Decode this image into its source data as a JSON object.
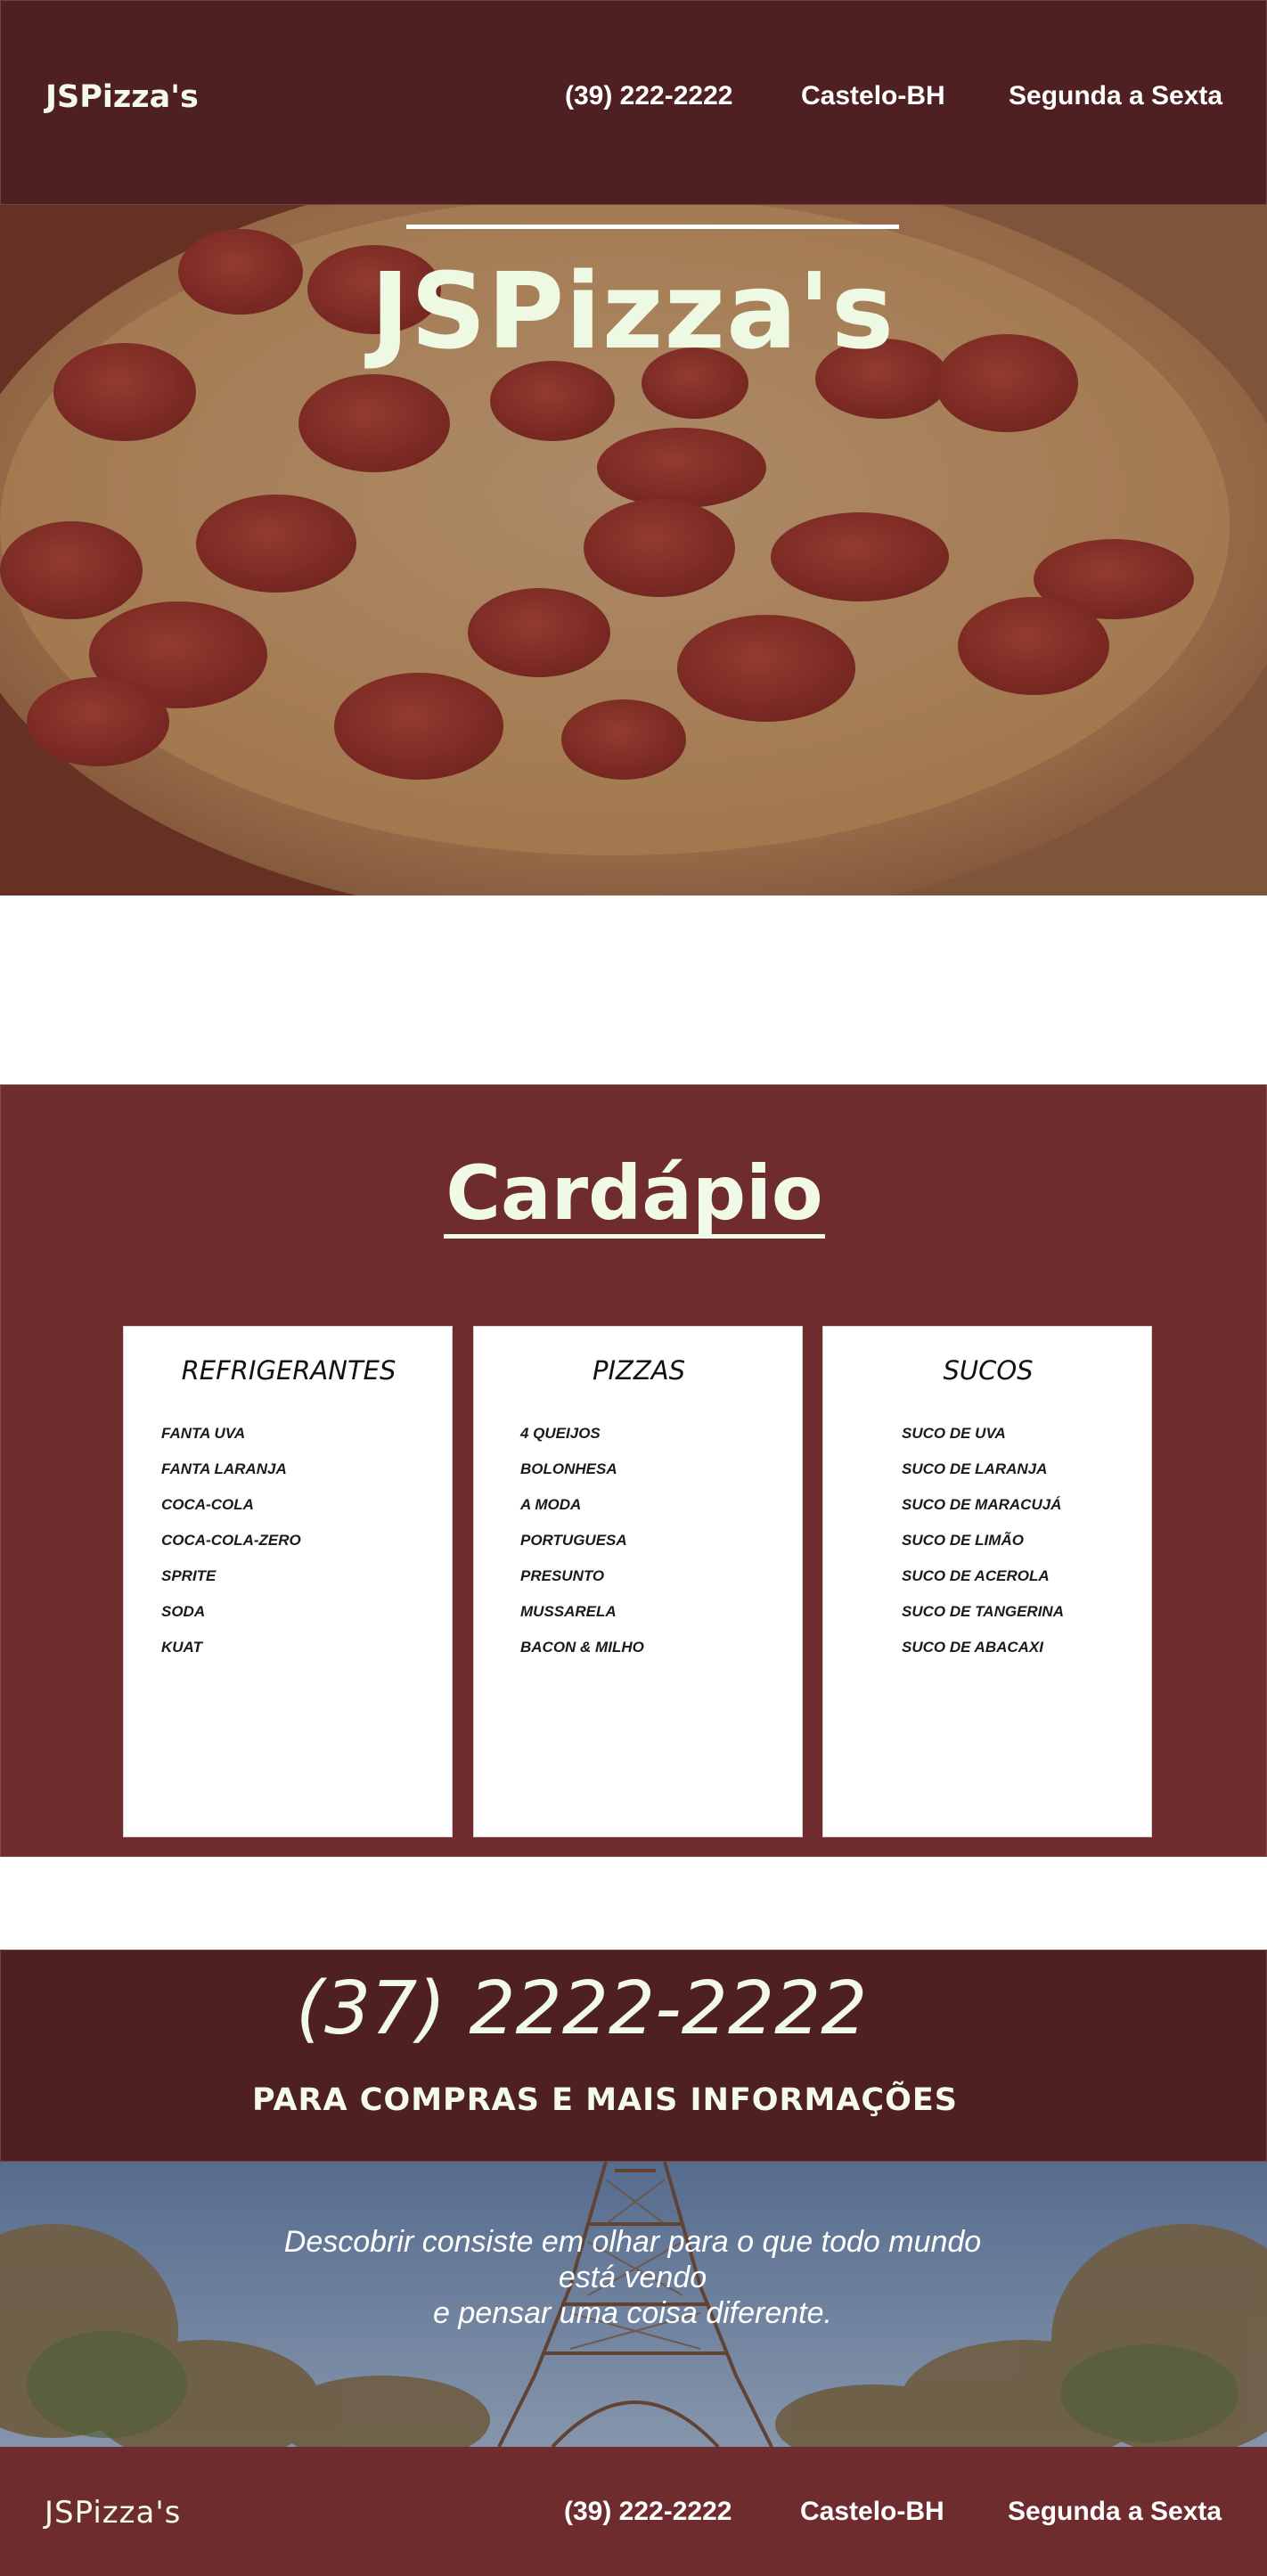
{
  "header": {
    "brand": "JSPizza's",
    "phone": "(39) 222-2222",
    "location": "Castelo-BH",
    "days": "Segunda a Sexta"
  },
  "hero": {
    "title": "JSPizza's",
    "image": "pepperoni-pizza-photo"
  },
  "menu": {
    "title": "Cardápio",
    "cards": [
      {
        "title": "REFRIGERANTES",
        "items": [
          "FANTA UVA",
          "FANTA LARANJA",
          "COCA-COLA",
          "COCA-COLA-ZERO",
          "SPRITE",
          "SODA",
          "KUAT"
        ]
      },
      {
        "title": "PIZZAS",
        "items": [
          "4 QUEIJOS",
          "BOLONHESA",
          "A MODA",
          "PORTUGUESA",
          "PRESUNTO",
          "MUSSARELA",
          "BACON & MILHO"
        ]
      },
      {
        "title": "SUCOS",
        "items": [
          "SUCO DE UVA",
          "SUCO DE LARANJA",
          "SUCO DE MARACUJÁ",
          "SUCO DE LIMÃO",
          "SUCO DE ACEROLA",
          "SUCO DE TANGERINA",
          "SUCO DE ABACAXI"
        ]
      }
    ]
  },
  "contact": {
    "phone": "(37) 2222-2222",
    "subtitle": "PARA COMPRAS E MAIS INFORMAÇÕES"
  },
  "quote": {
    "line1": "Descobrir consiste em olhar para o que todo mundo",
    "line2": "está vendo",
    "line3": "e pensar uma coisa diferente.",
    "image": "eiffel-tower-photo"
  },
  "footer": {
    "brand": "JSPizza's",
    "phone": "(39) 222-2222",
    "location": "Castelo-BH",
    "days": "Segunda a Sexta"
  },
  "colors": {
    "dark_maroon": "#4f2021",
    "maroon": "#6e2c2e",
    "cream": "#f1f9e7"
  }
}
